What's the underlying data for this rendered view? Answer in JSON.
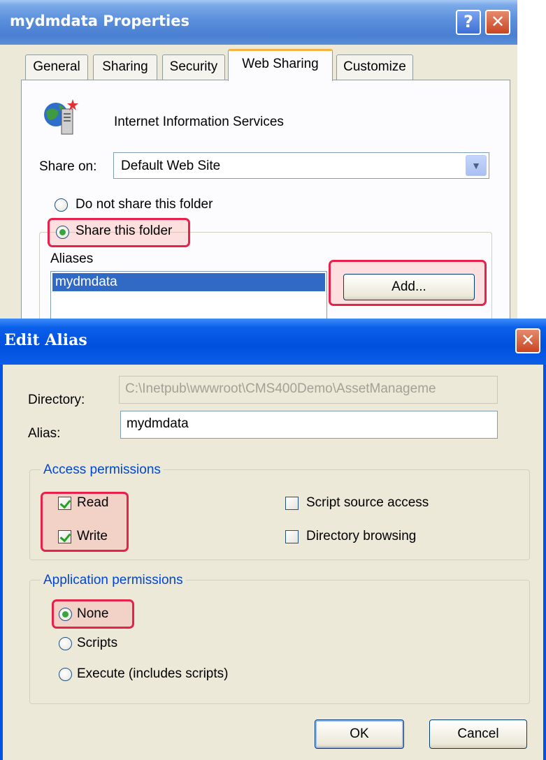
{
  "properties_window": {
    "title": "mydmdata Properties",
    "help_symbol": "?",
    "close_symbol": "✕",
    "tabs": [
      {
        "label": "General",
        "active": false
      },
      {
        "label": "Sharing",
        "active": false
      },
      {
        "label": "Security",
        "active": false
      },
      {
        "label": "Web Sharing",
        "active": true
      },
      {
        "label": "Customize",
        "active": false
      }
    ],
    "service_icon": "globe-server-icon",
    "service_name": "Internet Information Services",
    "share_on_label": "Share on:",
    "share_on_value": "Default Web Site",
    "dropdown_arrow": "▼",
    "do_not_share_label": "Do not share this folder",
    "share_label": "Share this folder",
    "share_selected": true,
    "aliases_label": "Aliases",
    "aliases": [
      "mydmdata"
    ],
    "add_button": "Add..."
  },
  "edit_alias_dialog": {
    "title": "Edit Alias",
    "close_symbol": "✕",
    "directory_label": "Directory:",
    "directory_value": "C:\\Inetpub\\wwwroot\\CMS400Demo\\AssetManageme",
    "alias_label": "Alias:",
    "alias_value": "mydmdata",
    "access_permissions": {
      "legend": "Access permissions",
      "read": {
        "label": "Read",
        "checked": true
      },
      "write": {
        "label": "Write",
        "checked": true
      },
      "script_source": {
        "label": "Script source access",
        "checked": false
      },
      "directory_browsing": {
        "label": "Directory browsing",
        "checked": false
      }
    },
    "application_permissions": {
      "legend": "Application permissions",
      "options": [
        "None",
        "Scripts",
        "Execute (includes scripts)"
      ],
      "selected": "None"
    },
    "ok_button": "OK",
    "cancel_button": "Cancel"
  },
  "colors": {
    "highlight": "#e8204a",
    "xp_blue": "#0054e3",
    "dialog_face": "#ece9d8",
    "selection": "#316ac5"
  }
}
